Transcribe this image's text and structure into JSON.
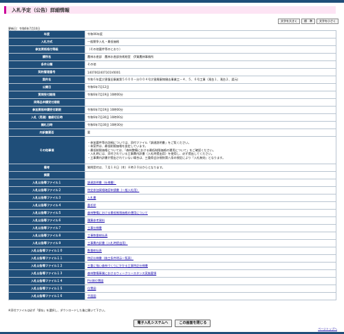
{
  "page_title": "入札予定（公告）詳細情報",
  "font_size_buttons": [
    "文字を大きく",
    "標　準",
    "文字を小さく"
  ],
  "updated_label": "更新日：令和6年7月10日",
  "rows": [
    {
      "label": "年度",
      "value": "令和06年度"
    },
    {
      "label": "入札方式",
      "value": "一般競争入札・最低価格"
    },
    {
      "label": "参加資格格付等級",
      "value": "（その他要件等のとおり）"
    },
    {
      "label": "課所名",
      "value": "農林水産部　農林水産部技術総室　伊賀農林事務所"
    },
    {
      "label": "条件分類",
      "value": "その他"
    },
    {
      "label": "契約管理番号",
      "value": "1407002407101V0001"
    },
    {
      "label": "案件名",
      "value": "令和６年度災害復旧事業第５６００－分００４号災害廃棄物撤去事業工－４、５、６号工事（滝台１、滝台２、渡元）"
    },
    {
      "label": "公開日",
      "value": "令和6年7月12日"
    },
    {
      "label": "質問受付期限",
      "value": "令和6年7月19日 10時00分"
    },
    {
      "label": "同等品申請受付期限",
      "value": ""
    },
    {
      "label": "参加資格申請受付期限",
      "value": "令和6年7月19日 10時00分"
    },
    {
      "label": "入札（見積）書締切日時",
      "value": "令和6年7月30日 10時00分"
    },
    {
      "label": "開札日時",
      "value": "令和6年7月30日 10時30分"
    },
    {
      "label": "内訳書要否",
      "value": "要"
    },
    {
      "label": "その他事項",
      "value": "",
      "lines": [
        "・参加要件等の詳細については、添付ファイル「調達説明書」をご覧ください。",
        "・本案件は、最低制限価格を設定しています。",
        "・最低制限価格については、「森林整備における最低制限価格の運用について」をご確認ください。",
        "・入札時には、添付されている工事費内訳書（入札時提出用）を使用し、必ず提出してください。",
        "・工事費内訳書が提出されていない場合は、三重県会計規則第八条の規定により「入札無効」となります。"
      ]
    },
    {
      "label": "備考",
      "value": "質問受付は、７月１８日（木）８時３０分からとなります。"
    },
    {
      "label": "摘要",
      "value": ""
    },
    {
      "label": "入札公告等ファイル１",
      "link": "調達説明書（仕様書）"
    },
    {
      "label": "入札公告等ファイル２",
      "link": "特定参加資格確認申請書（一般入札用）"
    },
    {
      "label": "入札公告等ファイル３",
      "link": "入札書"
    },
    {
      "label": "入札公告等ファイル４",
      "link": "委任状"
    },
    {
      "label": "入札公告等ファイル５",
      "link": "森林整備における最低制限価格の運用について"
    },
    {
      "label": "入札公告等ファイル６",
      "link": "積算参考資料"
    },
    {
      "label": "入札公告等ファイル７",
      "link": "工事仕様書"
    },
    {
      "label": "入札公告等ファイル８",
      "link": "工事数量総括表"
    },
    {
      "label": "入札公告等ファイル９",
      "link": "工事費内訳書（入札時提出用）"
    },
    {
      "label": "入札公告等ファイル１０",
      "link": "数量総括表"
    },
    {
      "label": "入札公告等ファイル１１",
      "link": "特記仕様書（施工条件明示一覧表）"
    },
    {
      "label": "入札公告等ファイル１２",
      "link": "三重に強い森林づくりにかかる工事特記仕様書"
    },
    {
      "label": "入札公告等ファイル１３",
      "link": "森林整備事業におけるウィークリースタンス実施要領"
    },
    {
      "label": "入札公告等ファイル１４",
      "link": "P分割位置図"
    },
    {
      "label": "入札公告等ファイル１５",
      "link": "位置図"
    },
    {
      "label": "入札公告等ファイル１６",
      "link": "平面図"
    }
  ],
  "footnote": "※添付ファイルは必ず「保存」を選択し、ダウンロードした後に開いて下さい。",
  "buttons": {
    "back": "電子入札システムへ",
    "close": "この画面を閉じる"
  },
  "page_top_link": "ページトップへ",
  "colors": {
    "header_bar": "#1f4e79",
    "title_bg": "#fde4f4",
    "title_accent": "#cc0099",
    "link": "#1a0dab"
  }
}
